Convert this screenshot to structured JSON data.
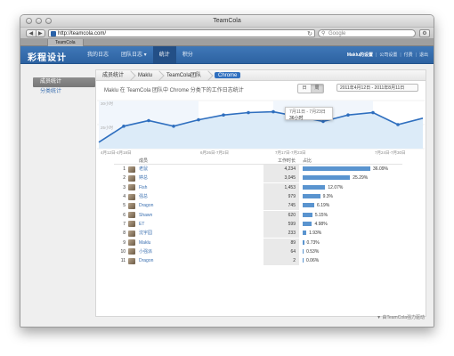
{
  "window": {
    "title": "TeamCola"
  },
  "browser": {
    "url": "http://teamcola.com/",
    "search_placeholder": "Google",
    "tab_title": "TeamCola",
    "back_glyph": "◀",
    "forward_glyph": "▶",
    "reload_glyph": "↻",
    "search_glyph": "⚲",
    "gear_glyph": "⚙"
  },
  "app": {
    "logo": "彩程设计",
    "nav": [
      "我的日志",
      "团队日志 ▾",
      "统计",
      "积分"
    ],
    "active_nav": 2,
    "user_links": [
      "Maklu的设置",
      "公司设置",
      "付费",
      "退出"
    ]
  },
  "sidebar": {
    "items": [
      "成员统计",
      "分类统计"
    ]
  },
  "breadcrumbs": [
    "成员统计",
    "Maklu",
    "TeamCola团队",
    "Chrome"
  ],
  "controls": {
    "subtitle": "Maklu 在 TeamCola 团队中 Chrome 分类下的工作日志统计",
    "seg_day": "日",
    "seg_week": "周",
    "date_range": "2011年4月12日 - 2011年8月11日"
  },
  "tooltip": {
    "line1": "7月11日 - 7月23日",
    "line2": "36小时"
  },
  "colors": {
    "accent": "#2f6fbf",
    "nav": "#3569aa",
    "bar": "#5a94cf"
  },
  "chart_data": {
    "type": "area",
    "x": [
      "4月12日-4月18日",
      "",
      "",
      "",
      "6月26日-7月2日",
      "",
      "",
      "7月17日-7月23日",
      "",
      "",
      "",
      "7月24日-7月30日",
      "",
      ""
    ],
    "series": [
      {
        "values": [
          8,
          28,
          35,
          28,
          36,
          42,
          45,
          46,
          40,
          34,
          42,
          45,
          30,
          38
        ]
      }
    ],
    "x_ticks": [
      "4月12日-4月18日",
      "6月26日-7月2日",
      "7月17日-7月23日",
      "7月24日-7月30日"
    ],
    "y_ticks": [
      "30小时",
      "25小时"
    ],
    "ylim": [
      0,
      60
    ],
    "grid": true
  },
  "table": {
    "headers": {
      "member": "成员",
      "hours": "工作时长",
      "percent": "占比"
    },
    "rows": [
      {
        "rank": "1",
        "name": "老鼠",
        "hours": "4,234",
        "pct": "36.09%",
        "frac": 0.3609
      },
      {
        "rank": "2",
        "name": "婷总",
        "hours": "3,045",
        "pct": "25.29%",
        "frac": 0.2529
      },
      {
        "rank": "3",
        "name": "Fish",
        "hours": "1,453",
        "pct": "12.07%",
        "frac": 0.1207
      },
      {
        "rank": "4",
        "name": "强总",
        "hours": "979",
        "pct": "9.3%",
        "frac": 0.093
      },
      {
        "rank": "5",
        "name": "Dragon",
        "hours": "745",
        "pct": "6.19%",
        "frac": 0.0619
      },
      {
        "rank": "6",
        "name": "Shawn",
        "hours": "620",
        "pct": "5.15%",
        "frac": 0.0515
      },
      {
        "rank": "7",
        "name": "ET",
        "hours": "599",
        "pct": "4.98%",
        "frac": 0.0498
      },
      {
        "rank": "8",
        "name": "沈宇园",
        "hours": "233",
        "pct": "1.93%",
        "frac": 0.0193
      },
      {
        "rank": "9",
        "name": "Maklu",
        "hours": "89",
        "pct": "0.73%",
        "frac": 0.0073
      },
      {
        "rank": "10",
        "name": "小强派",
        "hours": "64",
        "pct": "0.53%",
        "frac": 0.0053
      },
      {
        "rank": "11",
        "name": "Dragon",
        "hours": "2",
        "pct": "0.06%",
        "frac": 0.0006
      }
    ]
  },
  "footer": {
    "text": "▼ 由TeamCola强力驱动"
  }
}
